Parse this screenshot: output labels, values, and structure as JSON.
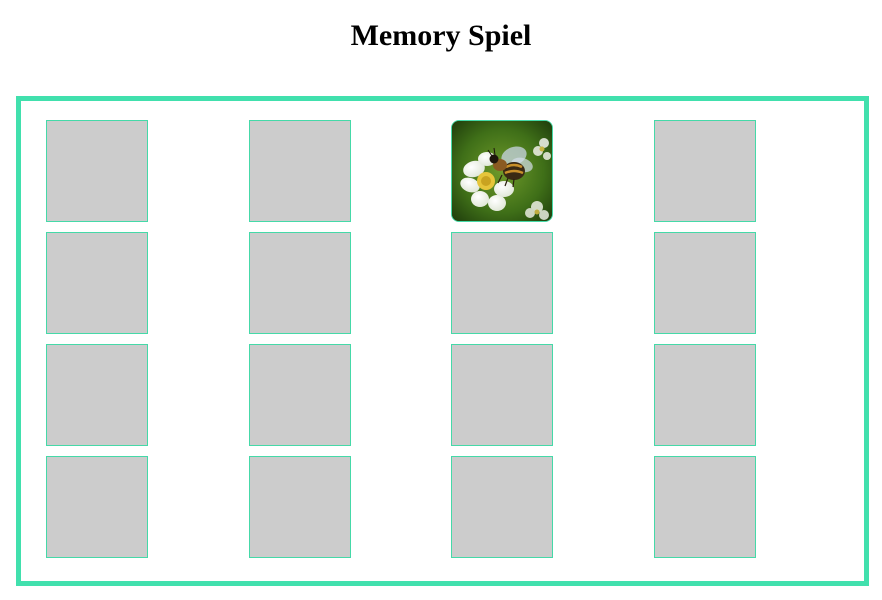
{
  "title": "Memory Spiel",
  "colors": {
    "board_border": "#41e0ad",
    "card_border": "#45d9a8",
    "card_back": "#cccccc"
  },
  "board": {
    "rows": 4,
    "columns": 4,
    "cards": [
      {
        "state": "hidden"
      },
      {
        "state": "hidden"
      },
      {
        "state": "revealed",
        "image": "bee-on-flower-image"
      },
      {
        "state": "hidden"
      },
      {
        "state": "hidden"
      },
      {
        "state": "hidden"
      },
      {
        "state": "hidden"
      },
      {
        "state": "hidden"
      },
      {
        "state": "hidden"
      },
      {
        "state": "hidden"
      },
      {
        "state": "hidden"
      },
      {
        "state": "hidden"
      },
      {
        "state": "hidden"
      },
      {
        "state": "hidden"
      },
      {
        "state": "hidden"
      },
      {
        "state": "hidden"
      }
    ]
  }
}
